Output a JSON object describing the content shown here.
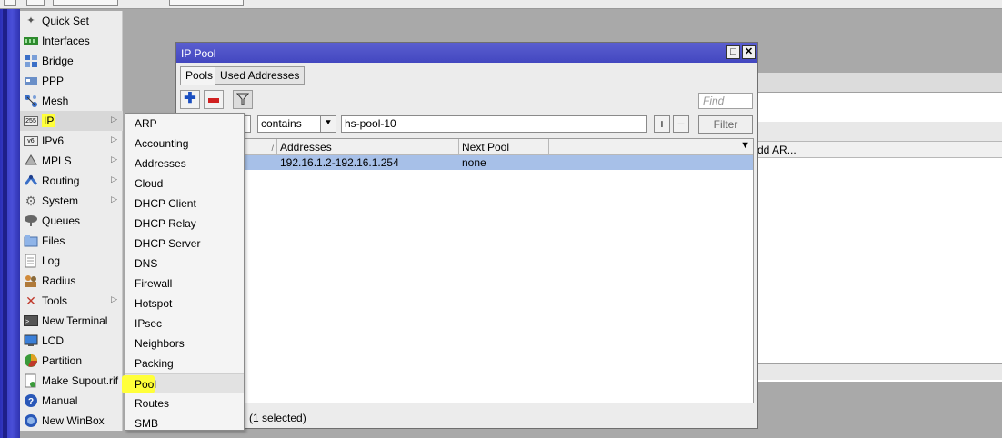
{
  "main_menu": {
    "items": [
      {
        "label": "Quick Set",
        "icon": "wand-icon",
        "submenu": false
      },
      {
        "label": "Interfaces",
        "icon": "interfaces-icon",
        "submenu": false
      },
      {
        "label": "Bridge",
        "icon": "bridge-icon",
        "submenu": false
      },
      {
        "label": "PPP",
        "icon": "ppp-icon",
        "submenu": false
      },
      {
        "label": "Mesh",
        "icon": "mesh-icon",
        "submenu": false
      },
      {
        "label": "IP",
        "icon": "ip-icon",
        "submenu": true
      },
      {
        "label": "IPv6",
        "icon": "ipv6-icon",
        "submenu": true
      },
      {
        "label": "MPLS",
        "icon": "mpls-icon",
        "submenu": true
      },
      {
        "label": "Routing",
        "icon": "routing-icon",
        "submenu": true
      },
      {
        "label": "System",
        "icon": "gear-icon",
        "submenu": true
      },
      {
        "label": "Queues",
        "icon": "queues-icon",
        "submenu": false
      },
      {
        "label": "Files",
        "icon": "folder-icon",
        "submenu": false
      },
      {
        "label": "Log",
        "icon": "log-icon",
        "submenu": false
      },
      {
        "label": "Radius",
        "icon": "radius-icon",
        "submenu": false
      },
      {
        "label": "Tools",
        "icon": "tools-icon",
        "submenu": true
      },
      {
        "label": "New Terminal",
        "icon": "terminal-icon",
        "submenu": false
      },
      {
        "label": "LCD",
        "icon": "lcd-icon",
        "submenu": false
      },
      {
        "label": "Partition",
        "icon": "partition-icon",
        "submenu": false
      },
      {
        "label": "Make Supout.rif",
        "icon": "document-icon",
        "submenu": false
      },
      {
        "label": "Manual",
        "icon": "help-icon",
        "submenu": false
      },
      {
        "label": "New WinBox",
        "icon": "winbox-icon",
        "submenu": false
      }
    ]
  },
  "ip_submenu": {
    "items": [
      "ARP",
      "Accounting",
      "Addresses",
      "Cloud",
      "DHCP Client",
      "DHCP Relay",
      "DHCP Server",
      "DNS",
      "Firewall",
      "Hotspot",
      "IPsec",
      "Neighbors",
      "Packing",
      "Pool",
      "Routes",
      "SMB"
    ],
    "selected": "Pool"
  },
  "ip_pool_window": {
    "title": "IP Pool",
    "tabs": [
      "Pools",
      "Used Addresses"
    ],
    "find_placeholder": "Find",
    "filter": {
      "operator": "contains",
      "value": "hs-pool-10",
      "button": "Filter"
    },
    "table": {
      "columns": [
        "Addresses",
        "Next Pool"
      ],
      "rows": [
        {
          "addresses": "192.16.1.2-192.16.1.254",
          "next_pool": "none"
        }
      ]
    },
    "status": "(1 selected)"
  },
  "background_window": {
    "column_label": "dd AR..."
  },
  "colors": {
    "left_bar": "#2b2fb8",
    "title_bar": "#4a4ec6",
    "selected_row": "#a7c0e8",
    "highlight": "#ffff3a"
  }
}
